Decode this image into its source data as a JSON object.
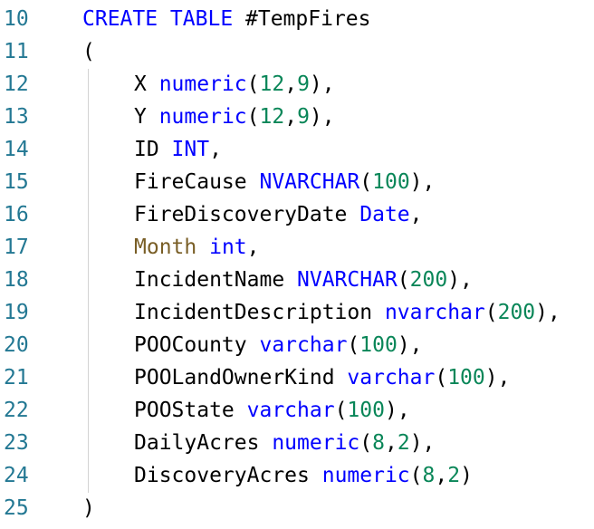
{
  "editor": {
    "lines": [
      {
        "number": "10",
        "tokens": [
          {
            "t": "CREATE TABLE",
            "c": "kw"
          },
          {
            "t": " #TempFires",
            "c": "txt"
          }
        ]
      },
      {
        "number": "11",
        "tokens": [
          {
            "t": "(",
            "c": "txt"
          }
        ]
      },
      {
        "number": "12",
        "tokens": [
          {
            "t": "X ",
            "c": "txt"
          },
          {
            "t": "numeric",
            "c": "kw"
          },
          {
            "t": "(",
            "c": "txt"
          },
          {
            "t": "12",
            "c": "num"
          },
          {
            "t": ",",
            "c": "txt"
          },
          {
            "t": "9",
            "c": "num"
          },
          {
            "t": "),",
            "c": "txt"
          }
        ]
      },
      {
        "number": "13",
        "tokens": [
          {
            "t": "Y ",
            "c": "txt"
          },
          {
            "t": "numeric",
            "c": "kw"
          },
          {
            "t": "(",
            "c": "txt"
          },
          {
            "t": "12",
            "c": "num"
          },
          {
            "t": ",",
            "c": "txt"
          },
          {
            "t": "9",
            "c": "num"
          },
          {
            "t": "),",
            "c": "txt"
          }
        ]
      },
      {
        "number": "14",
        "tokens": [
          {
            "t": "ID ",
            "c": "txt"
          },
          {
            "t": "INT",
            "c": "kw"
          },
          {
            "t": ",",
            "c": "txt"
          }
        ]
      },
      {
        "number": "15",
        "tokens": [
          {
            "t": "FireCause ",
            "c": "txt"
          },
          {
            "t": "NVARCHAR",
            "c": "kw"
          },
          {
            "t": "(",
            "c": "txt"
          },
          {
            "t": "100",
            "c": "num"
          },
          {
            "t": "),",
            "c": "txt"
          }
        ]
      },
      {
        "number": "16",
        "tokens": [
          {
            "t": "FireDiscoveryDate ",
            "c": "txt"
          },
          {
            "t": "Date",
            "c": "kw"
          },
          {
            "t": ",",
            "c": "txt"
          }
        ]
      },
      {
        "number": "17",
        "tokens": [
          {
            "t": "Month",
            "c": "fn"
          },
          {
            "t": " ",
            "c": "txt"
          },
          {
            "t": "int",
            "c": "kw"
          },
          {
            "t": ",",
            "c": "txt"
          }
        ]
      },
      {
        "number": "18",
        "tokens": [
          {
            "t": "IncidentName ",
            "c": "txt"
          },
          {
            "t": "NVARCHAR",
            "c": "kw"
          },
          {
            "t": "(",
            "c": "txt"
          },
          {
            "t": "200",
            "c": "num"
          },
          {
            "t": "),",
            "c": "txt"
          }
        ]
      },
      {
        "number": "19",
        "tokens": [
          {
            "t": "IncidentDescription ",
            "c": "txt"
          },
          {
            "t": "nvarchar",
            "c": "kw"
          },
          {
            "t": "(",
            "c": "txt"
          },
          {
            "t": "200",
            "c": "num"
          },
          {
            "t": "),",
            "c": "txt"
          }
        ]
      },
      {
        "number": "20",
        "tokens": [
          {
            "t": "POOCounty ",
            "c": "txt"
          },
          {
            "t": "varchar",
            "c": "kw"
          },
          {
            "t": "(",
            "c": "txt"
          },
          {
            "t": "100",
            "c": "num"
          },
          {
            "t": "),",
            "c": "txt"
          }
        ]
      },
      {
        "number": "21",
        "tokens": [
          {
            "t": "POOLandOwnerKind ",
            "c": "txt"
          },
          {
            "t": "varchar",
            "c": "kw"
          },
          {
            "t": "(",
            "c": "txt"
          },
          {
            "t": "100",
            "c": "num"
          },
          {
            "t": "),",
            "c": "txt"
          }
        ]
      },
      {
        "number": "22",
        "tokens": [
          {
            "t": "POOState ",
            "c": "txt"
          },
          {
            "t": "varchar",
            "c": "kw"
          },
          {
            "t": "(",
            "c": "txt"
          },
          {
            "t": "100",
            "c": "num"
          },
          {
            "t": "),",
            "c": "txt"
          }
        ]
      },
      {
        "number": "23",
        "tokens": [
          {
            "t": "DailyAcres ",
            "c": "txt"
          },
          {
            "t": "numeric",
            "c": "kw"
          },
          {
            "t": "(",
            "c": "txt"
          },
          {
            "t": "8",
            "c": "num"
          },
          {
            "t": ",",
            "c": "txt"
          },
          {
            "t": "2",
            "c": "num"
          },
          {
            "t": "),",
            "c": "txt"
          }
        ]
      },
      {
        "number": "24",
        "tokens": [
          {
            "t": "DiscoveryAcres ",
            "c": "txt"
          },
          {
            "t": "numeric",
            "c": "kw"
          },
          {
            "t": "(",
            "c": "txt"
          },
          {
            "t": "8",
            "c": "num"
          },
          {
            "t": ",",
            "c": "txt"
          },
          {
            "t": "2",
            "c": "num"
          },
          {
            "t": ")",
            "c": "txt"
          }
        ]
      },
      {
        "number": "25",
        "tokens": [
          {
            "t": ")",
            "c": "txt"
          }
        ]
      }
    ],
    "indented_lines": [
      "12",
      "13",
      "14",
      "15",
      "16",
      "17",
      "18",
      "19",
      "20",
      "21",
      "22",
      "23",
      "24"
    ]
  },
  "colors": {
    "line_number": "#237893",
    "keyword": "#0000ff",
    "number": "#098658",
    "function": "#795e26",
    "text": "#000000",
    "indent_guide": "#d3d3d3",
    "background": "#ffffff"
  }
}
